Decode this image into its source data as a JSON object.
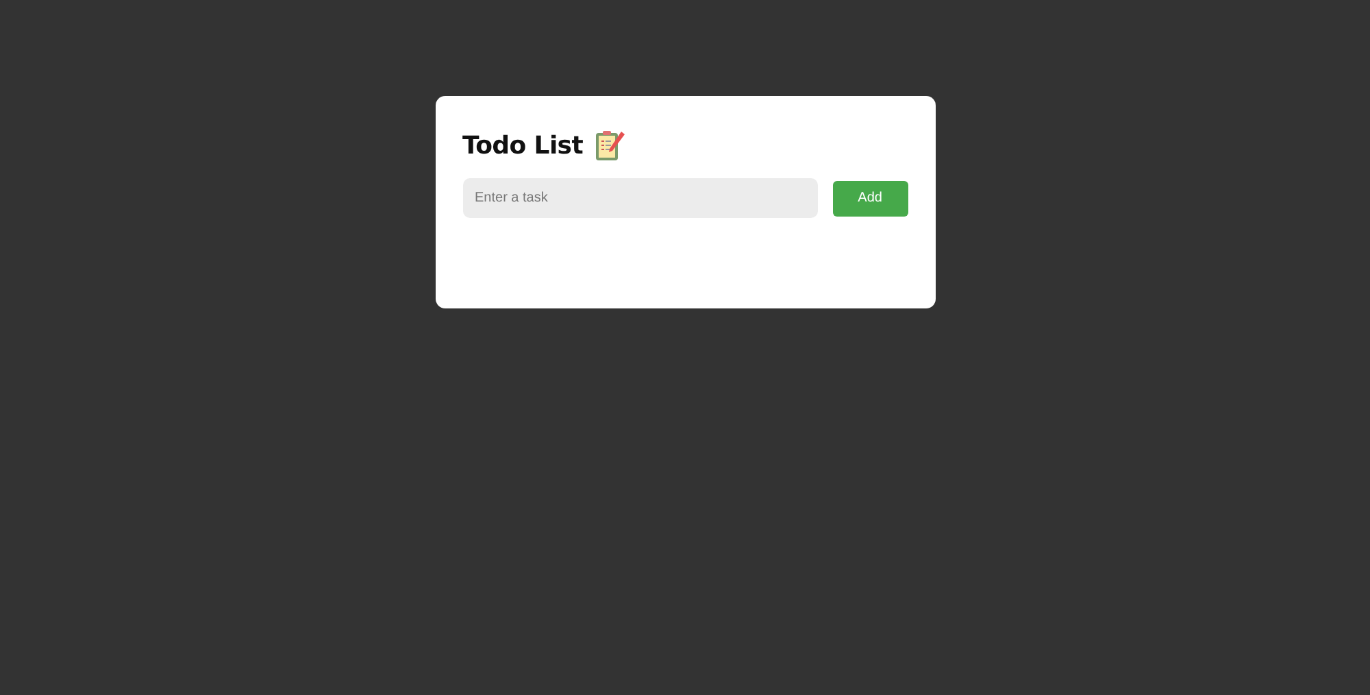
{
  "card": {
    "title": "Todo List",
    "task_input": {
      "placeholder": "Enter a task"
    },
    "add_button": {
      "label": "Add"
    }
  }
}
